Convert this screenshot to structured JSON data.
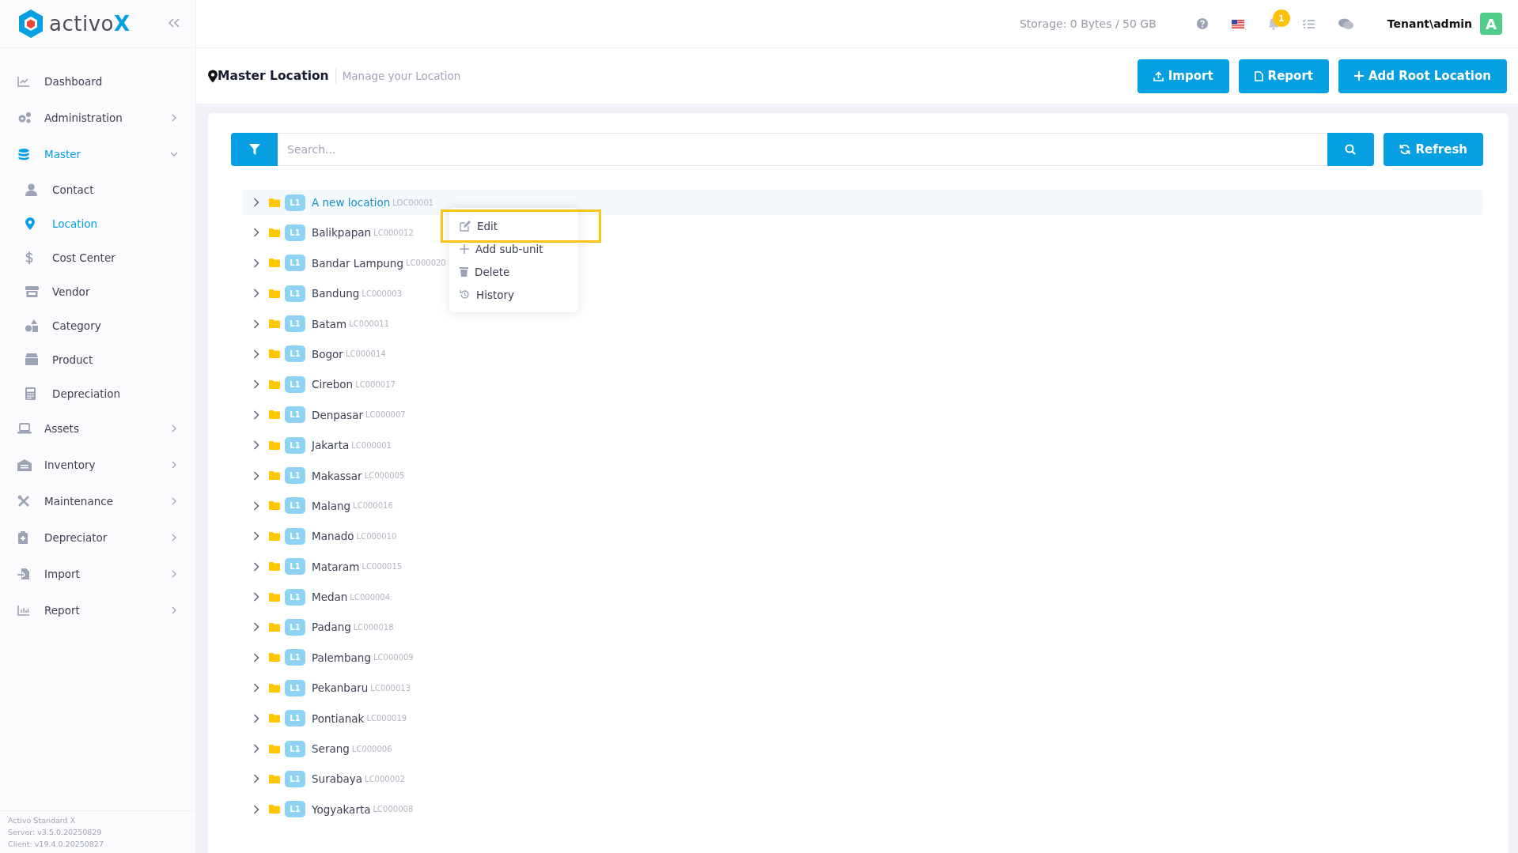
{
  "brand": {
    "name": "activo",
    "accent": "X"
  },
  "sidebar": {
    "items": [
      {
        "label": "Dashboard",
        "selected": false
      },
      {
        "label": "Administration",
        "selected": false,
        "expanded": false
      },
      {
        "label": "Master",
        "selected": true,
        "expanded": true,
        "children": [
          {
            "label": "Contact",
            "selected": false
          },
          {
            "label": "Location",
            "selected": true
          },
          {
            "label": "Cost Center",
            "selected": false
          },
          {
            "label": "Vendor",
            "selected": false
          },
          {
            "label": "Category",
            "selected": false
          },
          {
            "label": "Product",
            "selected": false
          },
          {
            "label": "Depreciation",
            "selected": false
          }
        ]
      },
      {
        "label": "Assets",
        "selected": false,
        "expanded": false
      },
      {
        "label": "Inventory",
        "selected": false,
        "expanded": false
      },
      {
        "label": "Maintenance",
        "selected": false,
        "expanded": false
      },
      {
        "label": "Depreciator",
        "selected": false,
        "expanded": false
      },
      {
        "label": "Import",
        "selected": false,
        "expanded": false
      },
      {
        "label": "Report",
        "selected": false,
        "expanded": false
      }
    ],
    "footer": [
      "Activo Standard X",
      "Server: v3.5.0.20250829",
      "Client: v19.4.0.20250827"
    ]
  },
  "topbar": {
    "storage": "Storage: 0 Bytes / 50 GB",
    "notification_count": "1",
    "user": "Tenant\\admin",
    "avatar": "A"
  },
  "page_header": {
    "title": "Master Location",
    "subtitle": "Manage your Location",
    "buttons": [
      "Import",
      "Report",
      "Add Root Location"
    ]
  },
  "search": {
    "placeholder": "Search...",
    "refresh": "Refresh"
  },
  "tree": [
    {
      "name": "A new location",
      "code": "LOC00001",
      "badge": "L1",
      "selected": true
    },
    {
      "name": "Balikpapan",
      "code": "LC000012",
      "badge": "L1",
      "selected": false
    },
    {
      "name": "Bandar Lampung",
      "code": "LC000020",
      "badge": "L1",
      "selected": false
    },
    {
      "name": "Bandung",
      "code": "LC000003",
      "badge": "L1",
      "selected": false
    },
    {
      "name": "Batam",
      "code": "LC000011",
      "badge": "L1",
      "selected": false
    },
    {
      "name": "Bogor",
      "code": "LC000014",
      "badge": "L1",
      "selected": false
    },
    {
      "name": "Cirebon",
      "code": "LC000017",
      "badge": "L1",
      "selected": false
    },
    {
      "name": "Denpasar",
      "code": "LC000007",
      "badge": "L1",
      "selected": false
    },
    {
      "name": "Jakarta",
      "code": "LC000001",
      "badge": "L1",
      "selected": false
    },
    {
      "name": "Makassar",
      "code": "LC000005",
      "badge": "L1",
      "selected": false
    },
    {
      "name": "Malang",
      "code": "LC000016",
      "badge": "L1",
      "selected": false
    },
    {
      "name": "Manado",
      "code": "LC000010",
      "badge": "L1",
      "selected": false
    },
    {
      "name": "Mataram",
      "code": "LC000015",
      "badge": "L1",
      "selected": false
    },
    {
      "name": "Medan",
      "code": "LC000004",
      "badge": "L1",
      "selected": false
    },
    {
      "name": "Padang",
      "code": "LC000018",
      "badge": "L1",
      "selected": false
    },
    {
      "name": "Palembang",
      "code": "LC000009",
      "badge": "L1",
      "selected": false
    },
    {
      "name": "Pekanbaru",
      "code": "LC000013",
      "badge": "L1",
      "selected": false
    },
    {
      "name": "Pontianak",
      "code": "LC000019",
      "badge": "L1",
      "selected": false
    },
    {
      "name": "Serang",
      "code": "LC000006",
      "badge": "L1",
      "selected": false
    },
    {
      "name": "Surabaya",
      "code": "LC000002",
      "badge": "L1",
      "selected": false
    },
    {
      "name": "Yogyakarta",
      "code": "LC000008",
      "badge": "L1",
      "selected": false
    }
  ],
  "context_menu": {
    "items": [
      {
        "label": "Edit",
        "selected": true
      },
      {
        "label": "Add sub-unit",
        "selected": false
      },
      {
        "label": "Delete",
        "selected": false
      },
      {
        "label": "History",
        "selected": false
      }
    ]
  }
}
